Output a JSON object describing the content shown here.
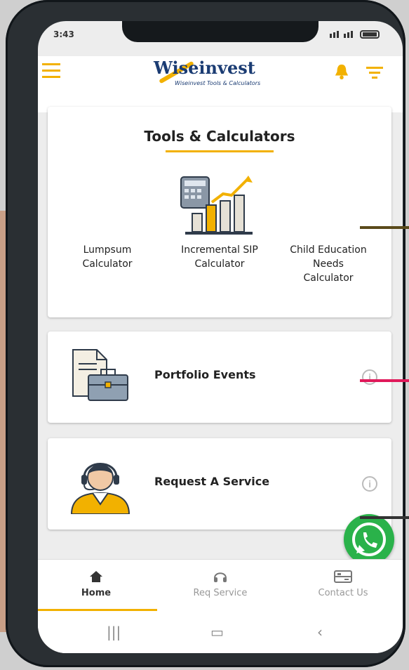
{
  "status": {
    "time": "3:43"
  },
  "header": {
    "logo_text": "Wiseinvest",
    "logo_tagline": "Wiseinvest Tools & Calculators"
  },
  "tools": {
    "title": "Tools & Calculators",
    "items": [
      {
        "label_line1": "Lumpsum",
        "label_line2": "Calculator",
        "label_line3": ""
      },
      {
        "label_line1": "Incremental SIP",
        "label_line2": "Calculator",
        "label_line3": ""
      },
      {
        "label_line1": "Child Education",
        "label_line2": "Needs",
        "label_line3": "Calculator"
      }
    ]
  },
  "portfolio": {
    "label": "Portfolio Events",
    "info": "i"
  },
  "service": {
    "label": "Request A Service",
    "info": "i"
  },
  "nav": {
    "tabs": [
      {
        "label": "Home",
        "icon": "home-icon"
      },
      {
        "label": "Req Service",
        "icon": "headset-icon"
      },
      {
        "label": "Contact Us",
        "icon": "contact-card-icon"
      }
    ]
  },
  "colors": {
    "accent": "#f2b100",
    "brand": "#1b3c73",
    "whatsapp": "#2ab24a"
  }
}
